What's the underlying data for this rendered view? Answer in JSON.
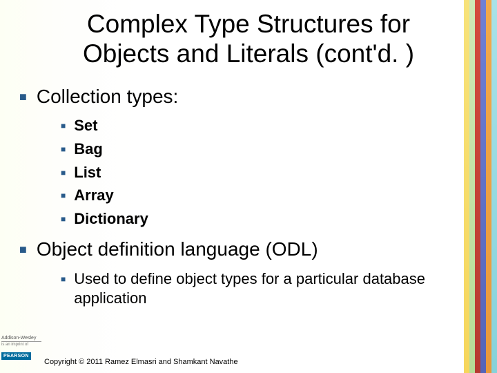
{
  "title": "Complex Type Structures for Objects and Literals (cont'd. )",
  "section1": {
    "heading": "Collection types:",
    "items": [
      "Set",
      "Bag",
      "List",
      "Array",
      "Dictionary"
    ]
  },
  "section2": {
    "heading": "Object definition language (ODL)",
    "items": [
      "Used to define object types for a particular database application"
    ]
  },
  "footer": {
    "publisher_line1": "Addison-Wesley",
    "publisher_line2": "is an imprint of",
    "brand": "PEARSON",
    "copyright": "Copyright © 2011 Ramez Elmasri and Shamkant Navathe"
  }
}
